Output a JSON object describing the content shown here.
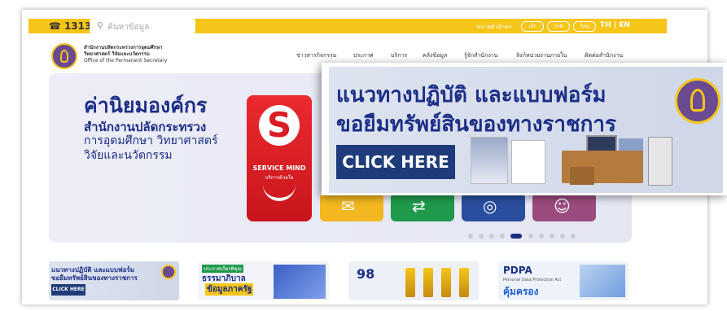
{
  "topbar": {
    "phone": "1313",
    "search_placeholder": "ค้นหาข้อมูล",
    "text_size_label": "ขนาดตัวอักษร",
    "size_options": [
      "เล็ก",
      "ปกติ",
      "ใหญ่"
    ],
    "lang_th": "TH",
    "lang_sep": "|",
    "lang_en": "EN"
  },
  "header": {
    "org_line1": "สำนักงานปลัดกระทรวงการอุดมศึกษา",
    "org_line2": "วิทยาศาสตร์ วิจัยและนวัตกรรม",
    "org_line3": "Office of the Permanent Secretary",
    "nav": [
      "ข่าวสารกิจกรรม",
      "ประกาศ",
      "บริการ",
      "คลังข้อมูล",
      "รู้จักสำนักงาน",
      "ลิงก์หน่วยงานภายใน",
      "ติดต่อสำนักงาน"
    ]
  },
  "hero": {
    "title": "ค่านิยมองค์กร",
    "subtitle": "สำนักงานปลัดกระทรวง",
    "line2": "การอุดมศึกษา วิทยาศาสตร์",
    "line3": "วิจัยและนวัตกรรม",
    "service_letter": "S",
    "service_title": "SERVICE MIND",
    "service_sub": "บริการด้วยใจ",
    "slide_count": 10,
    "active_slide": 5
  },
  "popup": {
    "line1": "แนวทางปฏิบัติ และแบบฟอร์ม",
    "line2": "ขอยืมทรัพย์สินของทางราชการ",
    "button": "CLICK HERE"
  },
  "cards": [
    {
      "line1": "แนวทางปฏิบัติ และแบบฟอร์ม",
      "line2": "ขอยืมทรัพย์สินของทางราชการ",
      "button": "CLICK HERE"
    },
    {
      "badge": "ประกาศเกียรติคุณ",
      "line1": "ธรรมาภิบาล",
      "line2": "ข้อมูลภาครัฐ"
    },
    {
      "number": "98"
    },
    {
      "title": "PDPA",
      "subtitle": "Personal Data Protection Act",
      "line2": "คุ้มครอง"
    }
  ],
  "colors": {
    "brand": "#1c2e86",
    "accent": "#f5c518",
    "service_red": "#d81d25"
  }
}
